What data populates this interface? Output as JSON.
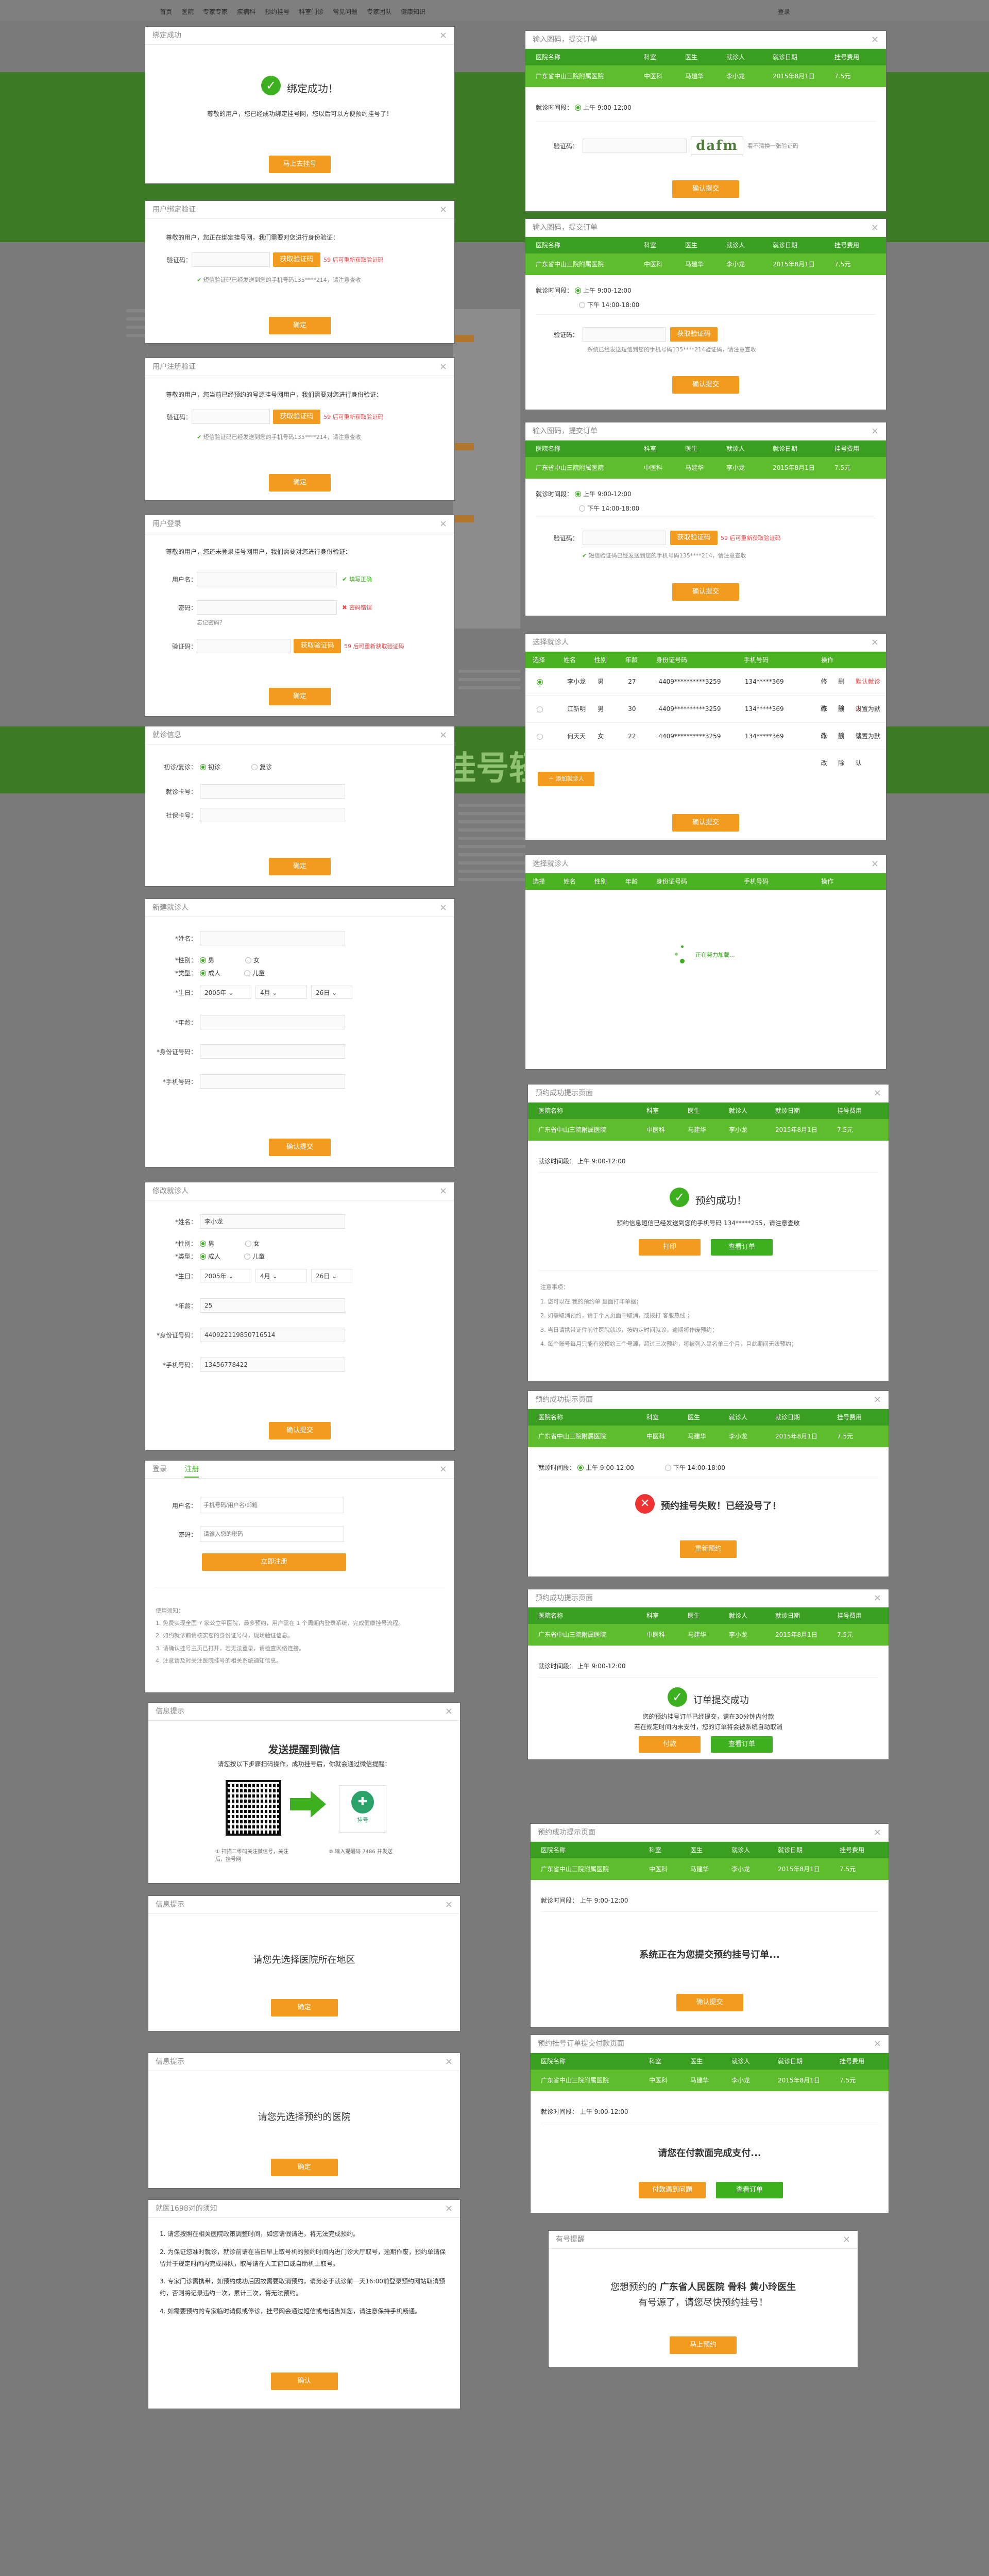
{
  "bg": {
    "nav_items": [
      "首页",
      "医院",
      "专家专家",
      "疾病科",
      "预约挂号",
      "科室门诊",
      "常见问题",
      "专家团队",
      "健康知识"
    ],
    "nav_right": "登录",
    "banner_text": "挂号轻"
  },
  "d1": {
    "title": "绑定成功",
    "heading": "绑定成功！",
    "body": "尊敬的用户，您已经成功绑定挂号网，您以后可以方便预约挂号了！",
    "btn": "马上去挂号"
  },
  "d2": {
    "title": "用户绑定验证",
    "intro": "尊敬的用户，您正在绑定挂号网，我们需要对您进行身份验证：",
    "label_code": "验证码：",
    "btn_get": "获取验证码",
    "hint": "59 后可重新获取验证码",
    "tip": "短信验证码已经发送到您的手机号码135****214，请注意查收",
    "btn": "确定"
  },
  "d3": {
    "title": "用户注册验证",
    "intro": "尊敬的用户，您当前已经预约的号源挂号网用户，我们需要对您进行身份验证：",
    "label_code": "验证码：",
    "btn_get": "获取验证码",
    "hint": "59 后可重新获取验证码",
    "tip": "短信验证码已经发送到您的手机号码135****214，请注意查收",
    "btn": "确定"
  },
  "d4": {
    "title": "用户登录",
    "intro": "尊敬的用户，您还未登录挂号网用户，我们需要对您进行身份验证：",
    "label_user": "用户名：",
    "ok": "填写正确",
    "label_pwd": "密码：",
    "err": "密码错误",
    "forgot": "忘记密码？",
    "label_code": "验证码：",
    "btn_get": "获取验证码",
    "hint": "59 后可重新获取验证码",
    "btn": "确定"
  },
  "d5": {
    "title": "就诊信息",
    "label_first": "初诊/复诊：",
    "opt1": "初诊",
    "opt2": "复诊",
    "label_card": "就诊卡号：",
    "label_ss": "社保卡号：",
    "btn": "确定"
  },
  "d6": {
    "title": "新建就诊人",
    "name": "*姓名：",
    "sex": "*性别：",
    "male": "男",
    "female": "女",
    "type": "*类型：",
    "adult": "成人",
    "child": "儿童",
    "birth": "*生日：",
    "year": "2005年",
    "month": "4月",
    "day": "26日",
    "age": "*年龄：",
    "idcard": "*身份证号码：",
    "phone": "*手机号码：",
    "btn": "确认提交"
  },
  "d7": {
    "title": "修改就诊人",
    "name": "*姓名：",
    "name_val": "李小龙",
    "sex": "*性别：",
    "male": "男",
    "female": "女",
    "type": "*类型：",
    "adult": "成人",
    "child": "儿童",
    "birth": "*生日：",
    "year": "2005年",
    "month": "4月",
    "day": "26日",
    "age": "*年龄：",
    "age_val": "25",
    "idcard": "*身份证号码：",
    "idcard_val": "440922119850716514",
    "phone": "*手机号码：",
    "phone_val": "13456778422",
    "btn": "确认提交"
  },
  "d8": {
    "tab_login": "登录",
    "tab_reg": "注册",
    "label_user": "用户名：",
    "ph_user": "手机号码/用户名/邮箱",
    "label_pwd": "密码：",
    "ph_pwd": "请输入您的密码",
    "btn": "立即注册",
    "rule_title": "使用须知：",
    "rules": [
      "1. 免费实现全国 7 家公立甲医院，最多预约，用户需在 1 个周期内登录系统，完成健康挂号流程。",
      "2. 如约就诊前请核实您的身份证号码，现场验证信息。",
      "3. 请确认挂号主页已打开，若无法登录，请检查网络连接。",
      "4. 注意请及时关注医院挂号的相关系统通知信息。"
    ]
  },
  "d9": {
    "title": "信息提示",
    "heading": "发送提醒到微信",
    "sub": "请您按以下步骤扫码操作，成功挂号后，你就会通过微信提醒：",
    "cap1": "① 扫描二维码关注微信号，关注后，挂号网",
    "logo_txt": "挂号",
    "cap2": "② 输入提醒码 7486 并发送"
  },
  "d10": {
    "title": "信息提示",
    "body": "请您先选择医院所在地区",
    "btn": "确定"
  },
  "d11": {
    "title": "信息提示",
    "body": "请您先选择预约的医院",
    "btn": "确定"
  },
  "d12": {
    "title": "就医1698对的须知",
    "items": [
      "1. 请您按照在相关医院政策调整时间，如您请假请进，将无法完成预约。",
      "2. 为保证您准时就诊，就诊前请在当日早上取号机的预约时间内进门诊大厅取号，逾期作废，预约单请保留并于规定时间内完成排队，取号请在人工窗口或自助机上取号。",
      "3. 专家门诊需携带，如预约成功后因故需要取消预约，请务必于就诊前一天16:00前登录预约网站取消预约，否则将记录违约一次，累计三次，将无法预约。",
      "4. 如需要预约的专家临时请假或停诊，挂号网会通过短信或电话告知您，请注意保持手机畅通。"
    ],
    "btn": "确认"
  },
  "tbl": {
    "h_hosp": "医院名称",
    "h_dept": "科室",
    "h_doc": "医生",
    "h_patient": "就诊人",
    "h_date": "就诊日期",
    "h_fee": "挂号费用",
    "hosp": "广东省中山三院附属医院",
    "dept": "中医科",
    "doc": "马建华",
    "patient": "李小龙",
    "date": "2015年8月1日",
    "fee": "7.5元",
    "am": "上午 9:00-12:00",
    "pm": "下午 14:00-18:00",
    "time_label": "就诊时间段："
  },
  "r1": {
    "title": "输入图码，提交订单",
    "label_code": "验证码：",
    "captcha": "dafm",
    "refresh": "看不清换一张验证码",
    "btn": "确认提交"
  },
  "r2": {
    "title": "输入图码，提交订单",
    "label_code": "验证码：",
    "btn_get": "获取验证码",
    "tip": "系统已经发送短信到您的手机号码135****214验证码，请注意查收",
    "btn": "确认提交"
  },
  "r3": {
    "title": "输入图码，提交订单",
    "label_code": "验证码：",
    "btn_get": "获取验证码",
    "hint": "59 后可重新获取验证码",
    "tip": "短信验证码已经发送到您的手机号码135****214，请注意查收",
    "btn": "确认提交"
  },
  "r4": {
    "title": "选择就诊人",
    "headers": [
      "选择",
      "姓名",
      "性别",
      "年龄",
      "身份证号码",
      "手机号码",
      "操作"
    ],
    "rows": [
      {
        "name": "李小龙",
        "sex": "男",
        "age": "27",
        "id": "4409**********3259",
        "tel": "134*****369",
        "edit": "修改",
        "del": "删除",
        "def": "默认就诊人"
      },
      {
        "name": "江新明",
        "sex": "男",
        "age": "30",
        "id": "4409**********3259",
        "tel": "134*****369",
        "edit": "修改",
        "del": "删除",
        "def": "设置为默认"
      },
      {
        "name": "何天天",
        "sex": "女",
        "age": "22",
        "id": "4409**********3259",
        "tel": "134*****369",
        "edit": "修改",
        "del": "删除",
        "def": "设置为默认"
      }
    ],
    "add": "添加就诊人",
    "btn": "确认提交"
  },
  "r5": {
    "title": "选择就诊人",
    "headers": [
      "选择",
      "姓名",
      "性别",
      "年龄",
      "身份证号码",
      "手机号码",
      "操作"
    ],
    "loading": "正在努力加载..."
  },
  "r6": {
    "title": "预约成功提示页面",
    "heading": "预约成功！",
    "sub": "预约信息短信已经发送到您的手机号码 134*****255，请注意查收",
    "btn1": "打印",
    "btn2": "查看订单",
    "notice_title": "注意事项：",
    "notices": [
      "1. 您可以在 我的预约单 里面打印单据；",
      "2. 如需取消预约，请于个人页面中取消，或拨打 客服热线 ；",
      "3. 当日请携带证件前往医院就诊，按约定时间就诊，逾期将作废预约；",
      "4. 每个账号每月只能有效预约三个号源，超过三次预约，将被列入黑名单三个月，且此期间无法预约；"
    ]
  },
  "r7": {
    "title": "预约成功提示页面",
    "heading": "预约挂号失败！已经没号了！",
    "btn": "重新预约"
  },
  "r8": {
    "title": "预约成功提示页面",
    "heading": "订单提交成功",
    "sub1": "您的预约挂号订单已经提交，请在30分钟内付款",
    "sub2": "若在规定时间内未支付，您的订单将会被系统自动取消",
    "btn1": "付款",
    "btn2": "查看订单"
  },
  "r9": {
    "title": "预约成功提示页面",
    "heading": "系统正在为您提交预约挂号订单...",
    "btn": "确认提交"
  },
  "r10": {
    "title": "预约挂号订单提交付款页面",
    "heading": "请您在付款面完成支付...",
    "btn1": "付款遇到问题",
    "btn2": "查看订单"
  },
  "r11": {
    "title": "有号提醒",
    "line1a": "您想预约的 ",
    "line1b": "广东省人民医院 骨科 黄小玲医生",
    "line2": "有号源了，请您尽快预约挂号！",
    "btn": "马上预约"
  },
  "close": "×"
}
